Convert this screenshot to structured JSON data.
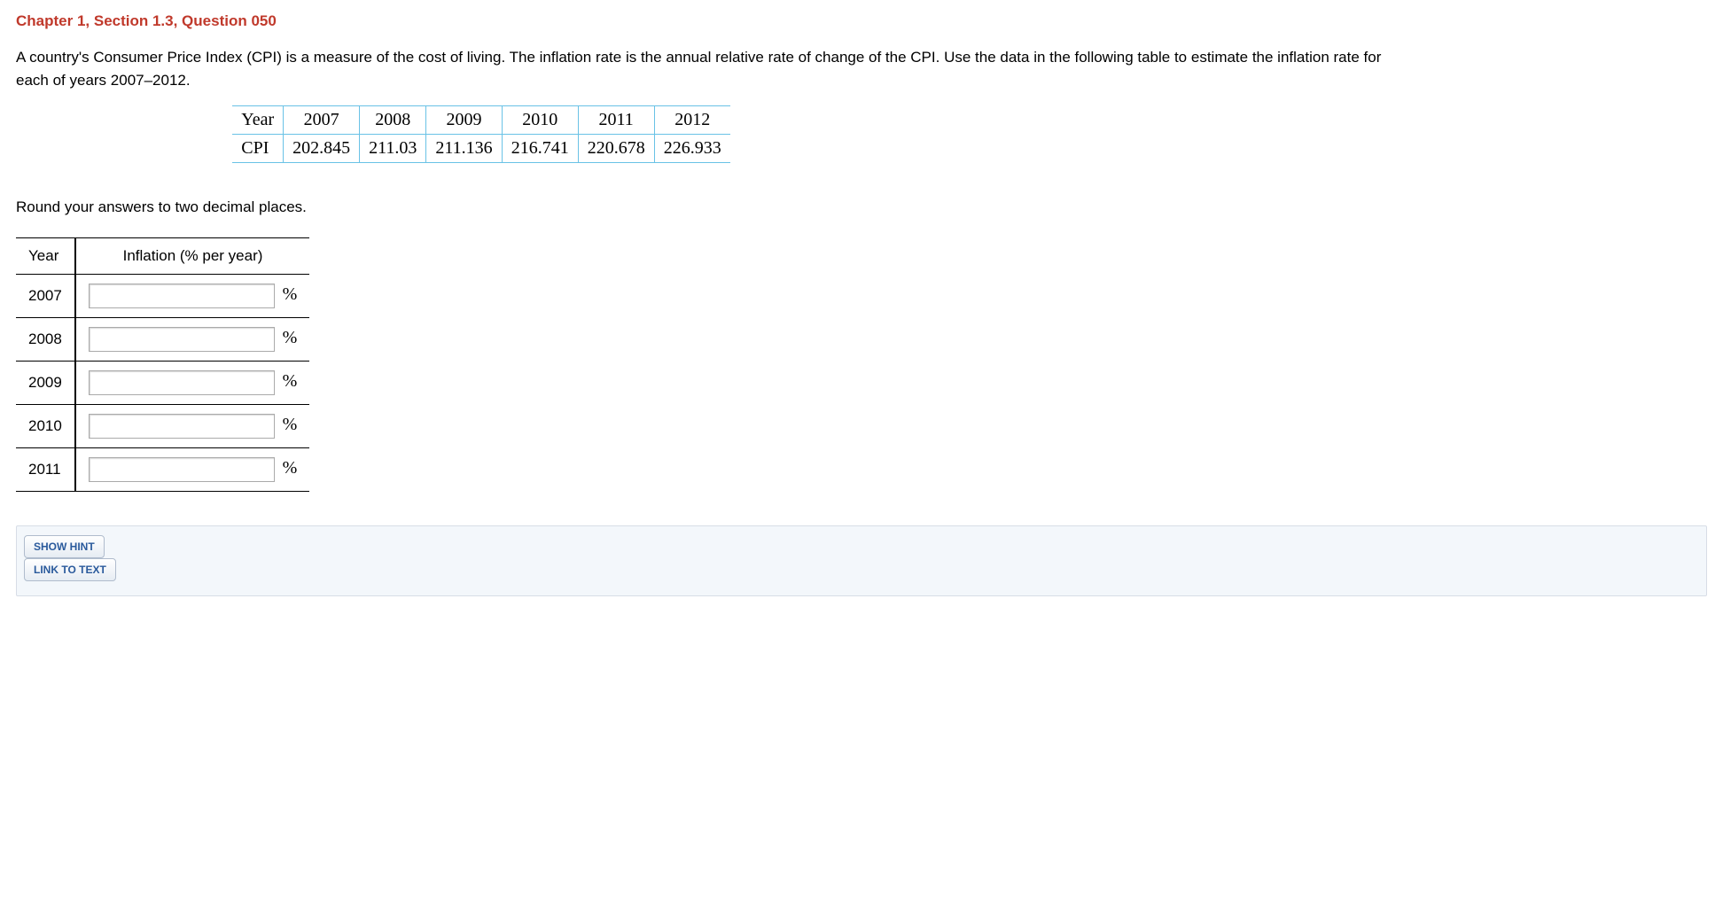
{
  "title": "Chapter 1, Section 1.3, Question 050",
  "description": "A country's Consumer Price Index (CPI) is a measure of the cost of living. The inflation rate is the annual relative rate of change of the CPI. Use the data in the following table to estimate the inflation rate for each of years 2007–2012.",
  "cpi_table": {
    "row1_label": "Year",
    "row2_label": "CPI",
    "years": [
      "2007",
      "2008",
      "2009",
      "2010",
      "2011",
      "2012"
    ],
    "cpi": [
      "202.845",
      "211.03",
      "211.136",
      "216.741",
      "220.678",
      "226.933"
    ]
  },
  "instruction": "Round your answers to two decimal places.",
  "answer_table": {
    "header_year": "Year",
    "header_inflation": "Inflation (% per year)",
    "rows": [
      {
        "year": "2007",
        "value": ""
      },
      {
        "year": "2008",
        "value": ""
      },
      {
        "year": "2009",
        "value": ""
      },
      {
        "year": "2010",
        "value": ""
      },
      {
        "year": "2011",
        "value": ""
      }
    ],
    "unit": "%"
  },
  "buttons": {
    "show_hint": "SHOW HINT",
    "link_to_text": "LINK TO TEXT"
  }
}
